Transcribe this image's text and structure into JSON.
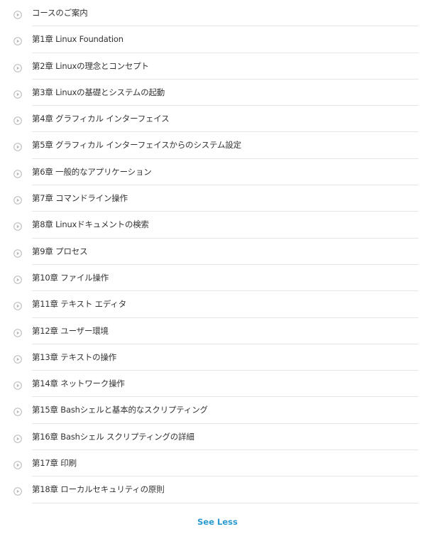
{
  "colors": {
    "accent": "#2a9bd1",
    "text": "#333333",
    "icon": "#b8b8b8",
    "divider": "#e6e6e6"
  },
  "syllabus": {
    "item_icon": "play-circle-icon",
    "items": [
      {
        "label": "コースのご案内"
      },
      {
        "label": "第1章 Linux Foundation"
      },
      {
        "label": "第2章 Linuxの理念とコンセプト"
      },
      {
        "label": "第3章 Linuxの基礎とシステムの起動"
      },
      {
        "label": "第4章 グラフィカル インターフェイス"
      },
      {
        "label": "第5章 グラフィカル インターフェイスからのシステム設定"
      },
      {
        "label": "第6章 一般的なアプリケーション"
      },
      {
        "label": "第7章 コマンドライン操作"
      },
      {
        "label": "第8章 Linuxドキュメントの検索"
      },
      {
        "label": "第9章 プロセス"
      },
      {
        "label": "第10章 ファイル操作"
      },
      {
        "label": "第11章 テキスト エディタ"
      },
      {
        "label": "第12章 ユーザー環境"
      },
      {
        "label": "第13章 テキストの操作"
      },
      {
        "label": "第14章 ネットワーク操作"
      },
      {
        "label": "第15章 Bashシェルと基本的なスクリプティング"
      },
      {
        "label": "第16章 Bashシェル スクリプティングの詳細"
      },
      {
        "label": "第17章 印刷"
      },
      {
        "label": "第18章 ローカルセキュリティの原則"
      }
    ],
    "toggle_label": "See Less"
  }
}
